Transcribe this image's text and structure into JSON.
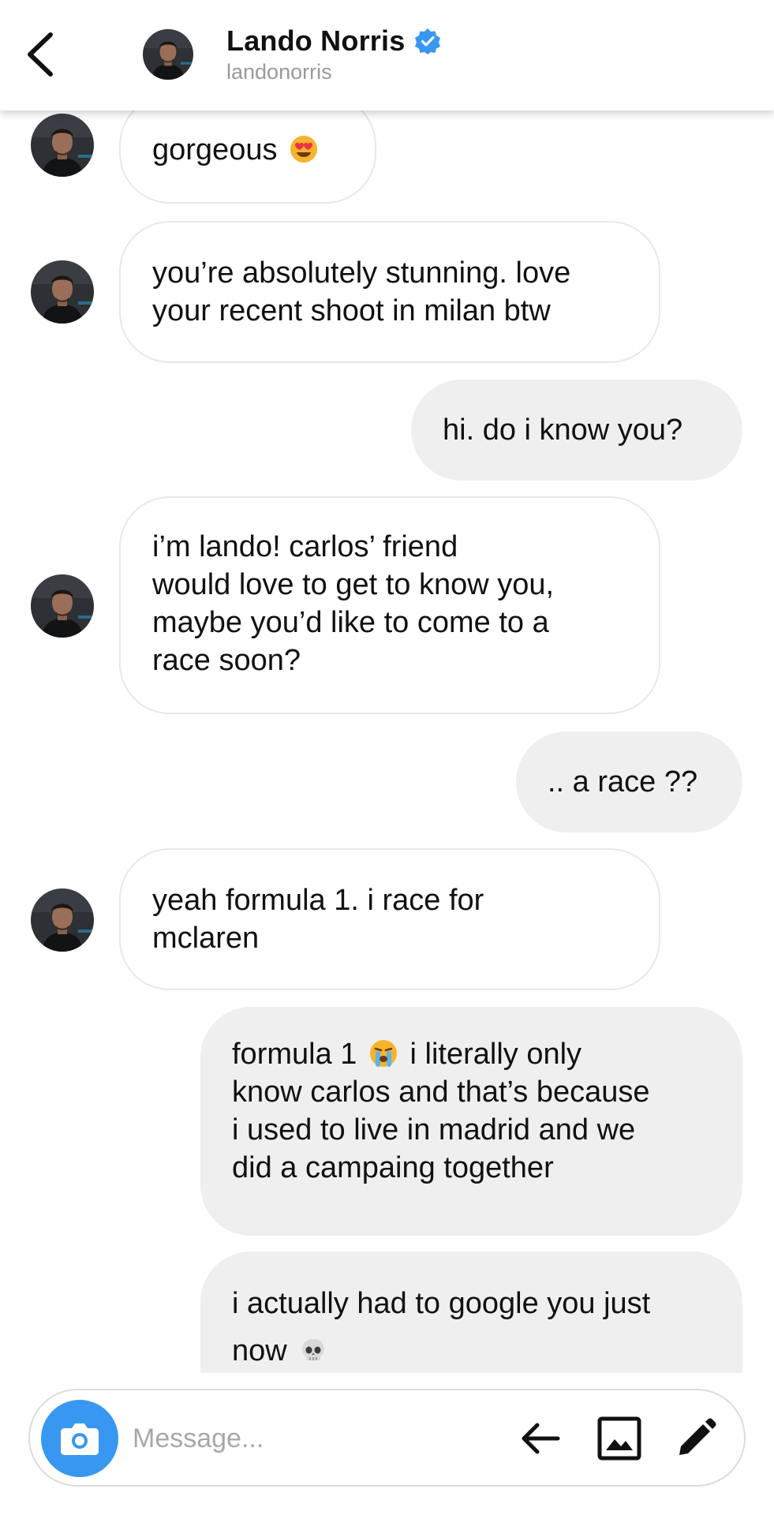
{
  "header": {
    "name": "Lando Norris",
    "username": "landonorris",
    "verified": true
  },
  "messages": [
    {
      "side": "in",
      "lines": [
        "gorgeous"
      ],
      "emoji": "heart-eyes-emoji"
    },
    {
      "side": "in",
      "lines": [
        "you’re absolutely stunning. love",
        "your recent shoot in milan btw"
      ]
    },
    {
      "side": "out",
      "lines": [
        "hi. do i know you?"
      ]
    },
    {
      "side": "in",
      "lines": [
        "i’m lando! carlos’ friend",
        "would love to get to know you,",
        "maybe you’d like to come to a",
        "race soon?"
      ]
    },
    {
      "side": "out",
      "lines": [
        ".. a race ??"
      ]
    },
    {
      "side": "in",
      "lines": [
        "yeah formula 1. i race for",
        "mclaren"
      ]
    },
    {
      "side": "out",
      "lines": [
        "formula 1",
        "i literally only",
        "know carlos and that’s because",
        "i used to live in madrid and we",
        "did a campaing together"
      ],
      "emoji": "loudly-crying-emoji"
    },
    {
      "side": "out",
      "lines": [
        "i actually had to google you just",
        "now"
      ],
      "emoji": "skull-emoji"
    }
  ],
  "composer": {
    "placeholder": "Message...",
    "icons": [
      "camera-icon",
      "arrow-left-icon",
      "image-icon",
      "pencil-icon"
    ]
  },
  "colors": {
    "accent": "#3897f0",
    "verified": "#3897f0",
    "outgoing_bubble": "#efefef",
    "incoming_border": "#e8e8e8"
  }
}
